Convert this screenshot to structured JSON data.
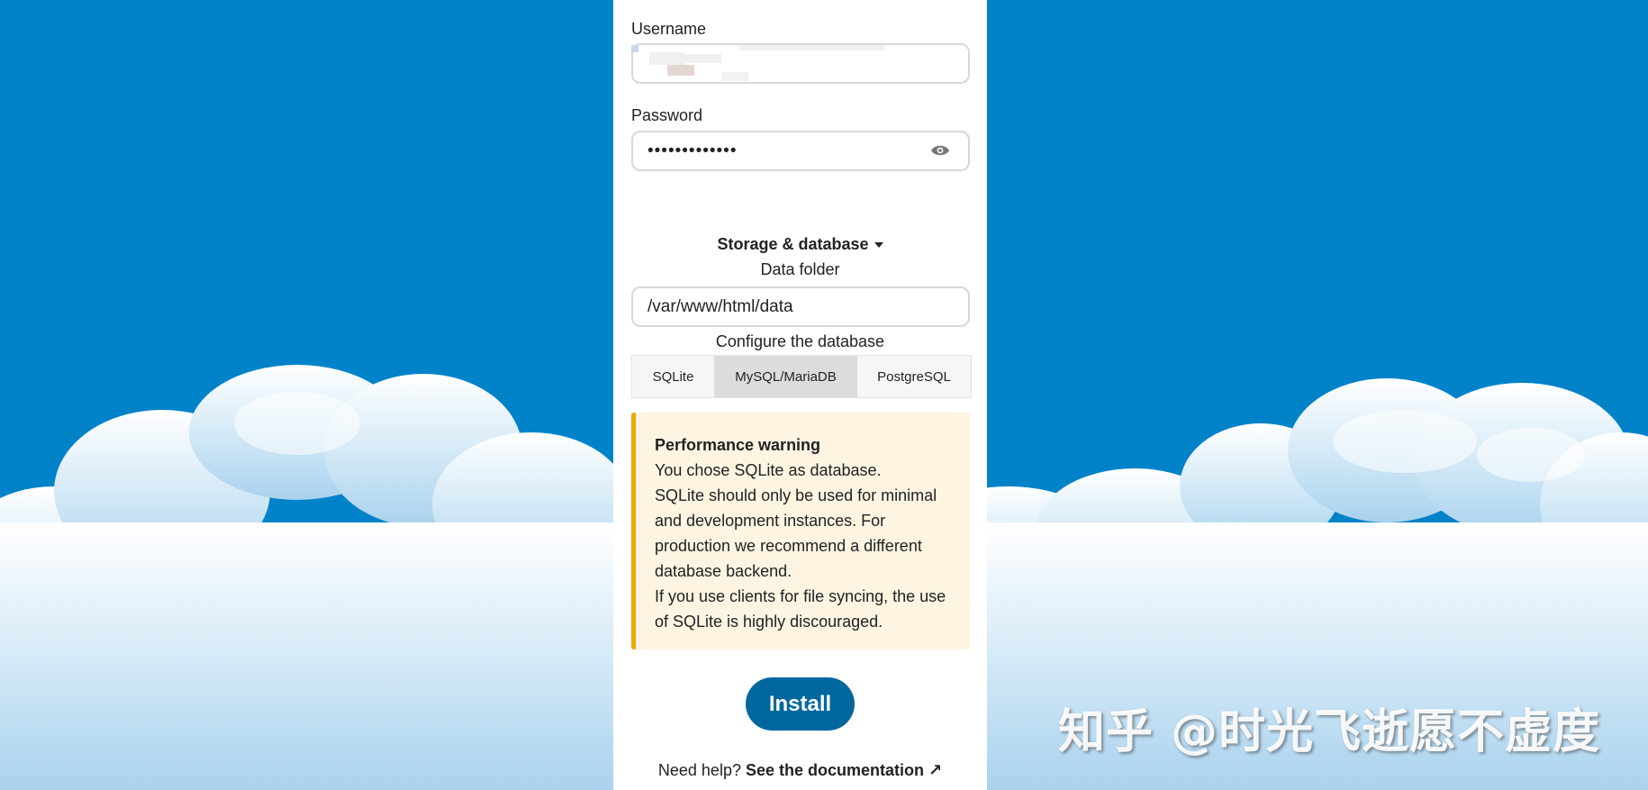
{
  "form": {
    "username_label": "Username",
    "password_label": "Password",
    "password_value": "•••••••••••••",
    "storage_toggle": "Storage & database",
    "data_folder_label": "Data folder",
    "data_folder_value": "/var/www/html/data",
    "configure_db_label": "Configure the database",
    "db_options": [
      "SQLite",
      "MySQL/MariaDB",
      "PostgreSQL"
    ],
    "db_selected": "MySQL/MariaDB",
    "warning": {
      "title": "Performance warning",
      "line1": "You chose SQLite as database.",
      "line2": "SQLite should only be used for minimal and development instances. For production we recommend a different database backend.",
      "line3": "If you use clients for file syncing, the use of SQLite is highly discouraged."
    },
    "install_label": "Install",
    "help_prefix": "Need help?",
    "help_link": "See the documentation ↗"
  },
  "watermark": "知乎 @时光飞逝愿不虚度",
  "colors": {
    "background": "#0082c9",
    "primary": "#00679e",
    "warning_border": "#f0a800",
    "warning_bg": "#fdf5e2"
  },
  "icons": [
    "eye-icon",
    "caret-down-icon"
  ]
}
